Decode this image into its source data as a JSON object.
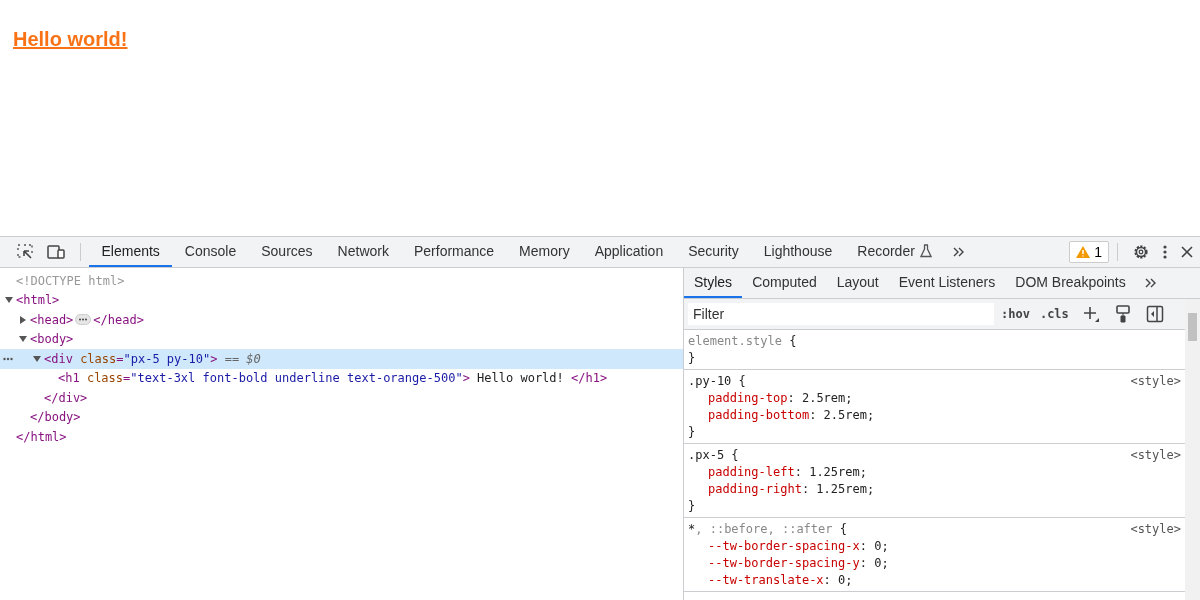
{
  "page": {
    "heading": "Hello world!"
  },
  "devtools": {
    "tabs": [
      {
        "label": "Elements",
        "selected": true
      },
      {
        "label": "Console",
        "selected": false
      },
      {
        "label": "Sources",
        "selected": false
      },
      {
        "label": "Network",
        "selected": false
      },
      {
        "label": "Performance",
        "selected": false
      },
      {
        "label": "Memory",
        "selected": false
      },
      {
        "label": "Application",
        "selected": false
      },
      {
        "label": "Security",
        "selected": false
      },
      {
        "label": "Lighthouse",
        "selected": false
      },
      {
        "label": "Recorder",
        "selected": false,
        "experimental": true
      }
    ],
    "warnings": "1",
    "dom": [
      {
        "open": [
          {
            "kind": "comment",
            "text": "<!DOCTYPE html>"
          }
        ],
        "selected": false
      },
      {
        "open": [
          {
            "kind": "tag",
            "text": "<html>"
          }
        ],
        "close": [
          {
            "kind": "tag",
            "text": "</html>"
          }
        ],
        "expanded": true,
        "selected": false,
        "children": [
          {
            "open": [
              {
                "kind": "tag",
                "text": "<head>"
              }
            ],
            "close": [
              {
                "kind": "tag",
                "text": "</head>"
              }
            ],
            "expanded": false,
            "selected": false
          },
          {
            "open": [
              {
                "kind": "tag",
                "text": "<body>"
              }
            ],
            "close": [
              {
                "kind": "tag",
                "text": "</body>"
              }
            ],
            "expanded": true,
            "selected": false,
            "children": [
              {
                "open": [
                  {
                    "kind": "tag",
                    "text": "<div"
                  },
                  {
                    "kind": "attr",
                    "text": " class"
                  },
                  {
                    "kind": "punct",
                    "text": "="
                  },
                  {
                    "kind": "value",
                    "text": "\"px-5 py-10\""
                  },
                  {
                    "kind": "tag",
                    "text": ">"
                  },
                  {
                    "kind": "marker",
                    "text": " == $0"
                  }
                ],
                "close": [
                  {
                    "kind": "tag",
                    "text": "</div>"
                  }
                ],
                "expanded": true,
                "selected": true,
                "children": [
                  {
                    "open": [
                      {
                        "kind": "tag",
                        "text": "<h1"
                      },
                      {
                        "kind": "attr",
                        "text": " class"
                      },
                      {
                        "kind": "punct",
                        "text": "="
                      },
                      {
                        "kind": "value",
                        "text": "\"text-3xl font-bold underline text-orange-500\""
                      },
                      {
                        "kind": "tag",
                        "text": ">"
                      },
                      {
                        "kind": "text",
                        "text": " Hello world! "
                      },
                      {
                        "kind": "tag",
                        "text": "</h1>"
                      }
                    ],
                    "selected": false
                  }
                ]
              }
            ]
          }
        ]
      }
    ],
    "sidebar_tabs": [
      {
        "label": "Styles",
        "selected": true
      },
      {
        "label": "Computed",
        "selected": false
      },
      {
        "label": "Layout",
        "selected": false
      },
      {
        "label": "Event Listeners",
        "selected": false
      },
      {
        "label": "DOM Breakpoints",
        "selected": false
      }
    ],
    "filter": {
      "placeholder": "Filter"
    },
    "toggles": [
      ":hov",
      ".cls"
    ],
    "rules": [
      {
        "selector": [
          {
            "text": "element.style",
            "matched": false
          }
        ],
        "open": " {",
        "close": "}"
      },
      {
        "selector": [
          {
            "text": ".py-10",
            "matched": true
          }
        ],
        "open": " {",
        "close": "}",
        "source": "<style>",
        "props": [
          {
            "name": "padding-top",
            "rest": ": 2.5rem;"
          },
          {
            "name": "padding-bottom",
            "rest": ": 2.5rem;"
          }
        ]
      },
      {
        "selector": [
          {
            "text": ".px-5",
            "matched": true
          }
        ],
        "open": " {",
        "close": "}",
        "source": "<style>",
        "props": [
          {
            "name": "padding-left",
            "rest": ": 1.25rem;"
          },
          {
            "name": "padding-right",
            "rest": ": 1.25rem;"
          }
        ]
      },
      {
        "selector": [
          {
            "text": "*",
            "matched": true
          },
          {
            "text": ", ::before, ::after",
            "matched": false
          }
        ],
        "open": " {",
        "source": "<style>",
        "props": [
          {
            "name": "--tw-border-spacing-x",
            "rest": ": 0;"
          },
          {
            "name": "--tw-border-spacing-y",
            "rest": ": 0;"
          },
          {
            "name": "--tw-translate-x",
            "rest": ": 0;"
          }
        ]
      }
    ]
  }
}
